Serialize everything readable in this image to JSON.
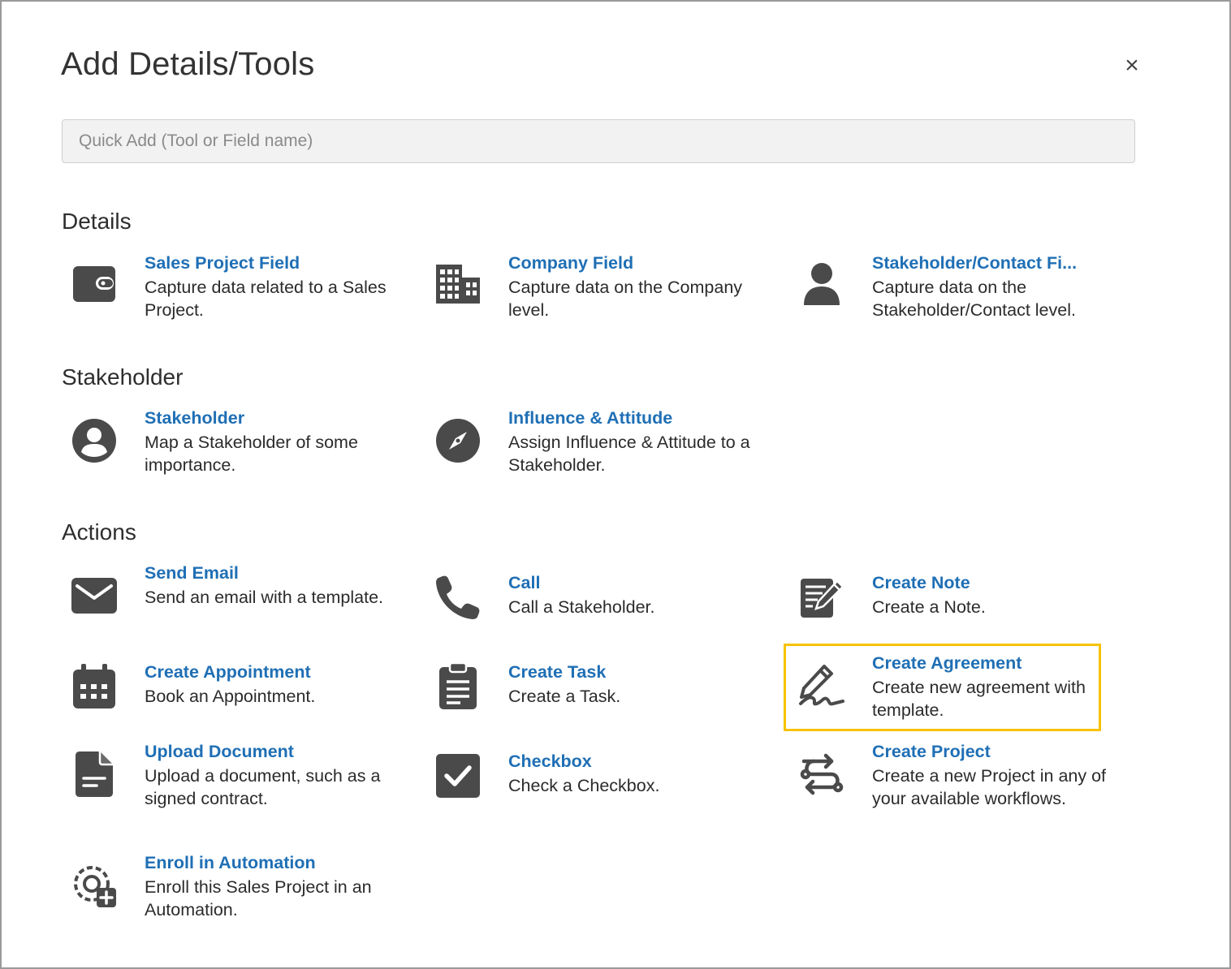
{
  "dialog": {
    "title": "Add Details/Tools",
    "close_label": "×"
  },
  "search": {
    "placeholder": "Quick Add (Tool or Field name)",
    "value": ""
  },
  "sections": {
    "details": "Details",
    "stakeholder": "Stakeholder",
    "actions": "Actions"
  },
  "items": {
    "sales_project_field": {
      "name": "Sales Project Field",
      "desc": "Capture data related to a Sales Project.",
      "icon": "wallet-icon"
    },
    "company_field": {
      "name": "Company Field",
      "desc": "Capture data on the Company level.",
      "icon": "building-icon"
    },
    "stakeholder_contact_field": {
      "name": "Stakeholder/Contact Fi...",
      "desc": "Capture data on the Stakeholder/Contact level.",
      "icon": "user-icon"
    },
    "stakeholder": {
      "name": "Stakeholder",
      "desc": "Map a Stakeholder of some importance.",
      "icon": "user-circle-icon"
    },
    "influence_attitude": {
      "name": "Influence & Attitude",
      "desc": "Assign Influence & Attitude to a Stakeholder.",
      "icon": "compass-icon"
    },
    "send_email": {
      "name": "Send Email",
      "desc": "Send an email with a template.",
      "icon": "envelope-icon"
    },
    "call": {
      "name": "Call",
      "desc": "Call a Stakeholder.",
      "icon": "phone-icon"
    },
    "create_note": {
      "name": "Create Note",
      "desc": "Create a Note.",
      "icon": "edit-note-icon"
    },
    "create_appointment": {
      "name": "Create Appointment",
      "desc": "Book an Appointment.",
      "icon": "calendar-icon"
    },
    "create_task": {
      "name": "Create Task",
      "desc": "Create a Task.",
      "icon": "clipboard-icon"
    },
    "create_agreement": {
      "name": "Create Agreement",
      "desc": "Create new agreement with template.",
      "icon": "signature-icon"
    },
    "upload_document": {
      "name": "Upload Document",
      "desc": "Upload a document, such as a signed contract.",
      "icon": "document-icon"
    },
    "checkbox": {
      "name": "Checkbox",
      "desc": "Check a Checkbox.",
      "icon": "checkbox-icon"
    },
    "create_project": {
      "name": "Create Project",
      "desc": "Create a new Project in any of your available workflows.",
      "icon": "workflow-icon"
    },
    "enroll_automation": {
      "name": "Enroll in Automation",
      "desc": "Enroll this Sales Project in an Automation.",
      "icon": "automation-gear-icon"
    }
  },
  "colors": {
    "link": "#1f6fb5",
    "icon": "#4a4a4a",
    "highlight": "#f6c200"
  }
}
